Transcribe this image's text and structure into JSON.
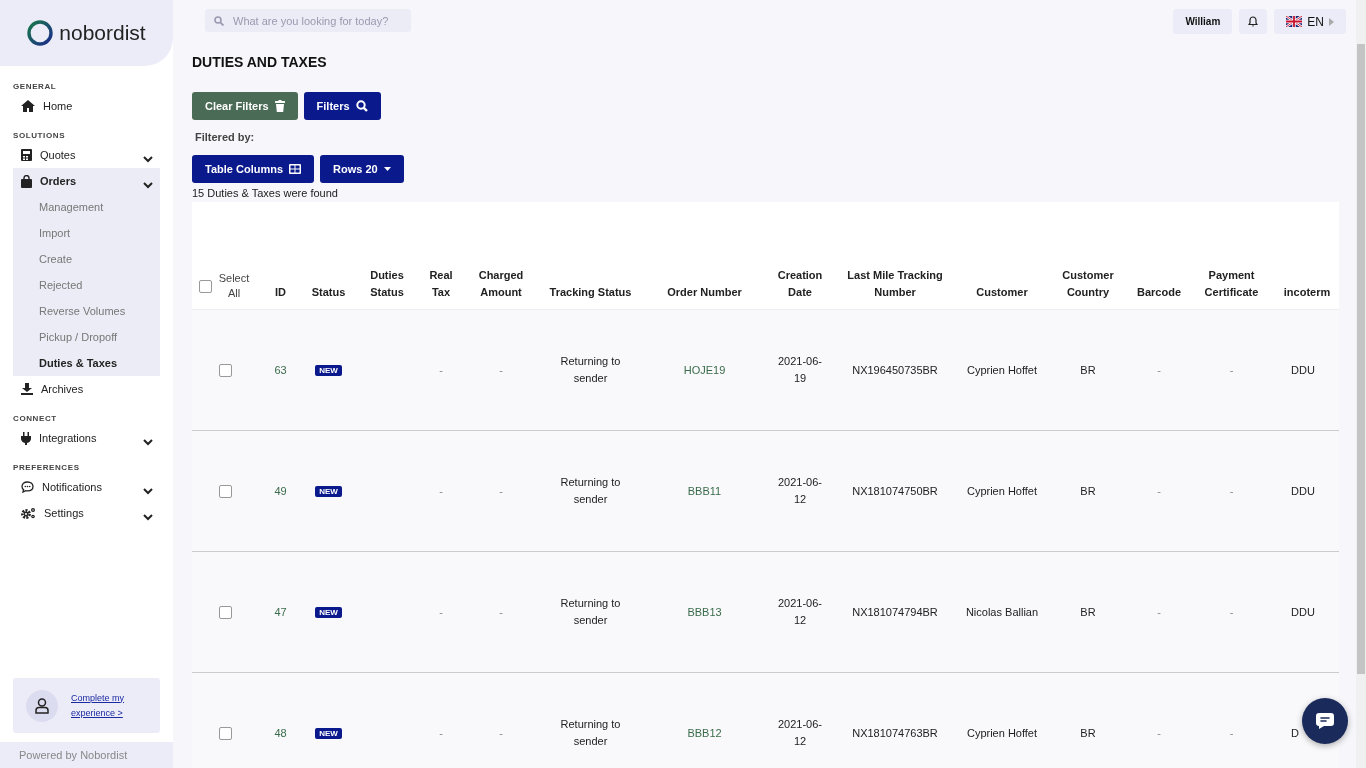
{
  "logo": {
    "text": "nobordist"
  },
  "search": {
    "placeholder": "What are you looking for today?"
  },
  "topbar": {
    "user": "William",
    "language": "EN"
  },
  "sidebar": {
    "sections": [
      {
        "title": "GENERAL",
        "items": [
          {
            "label": "Home",
            "selected": false
          }
        ]
      },
      {
        "title": "SOLUTIONS",
        "items": [
          {
            "label": "Quotes",
            "selected": false,
            "expanded": false
          },
          {
            "label": "Orders",
            "selected": true,
            "expanded": true,
            "children": [
              {
                "label": "Management",
                "selected": false
              },
              {
                "label": "Import",
                "selected": false
              },
              {
                "label": "Create",
                "selected": false
              },
              {
                "label": "Rejected",
                "selected": false
              },
              {
                "label": "Reverse Volumes",
                "selected": false
              },
              {
                "label": "Pickup / Dropoff",
                "selected": false
              },
              {
                "label": "Duties & Taxes",
                "selected": true
              }
            ]
          },
          {
            "label": "Archives",
            "selected": false
          }
        ]
      },
      {
        "title": "CONNECT",
        "items": [
          {
            "label": "Integrations",
            "selected": false,
            "expanded": false
          }
        ]
      },
      {
        "title": "PREFERENCES",
        "items": [
          {
            "label": "Notifications",
            "selected": false,
            "expanded": false
          },
          {
            "label": "Settings",
            "selected": false,
            "expanded": false
          }
        ]
      }
    ],
    "profile_link": "Complete my experience >",
    "footer": "Powered by Nobordist"
  },
  "page": {
    "title": "DUTIES AND TAXES",
    "clear_filters": "Clear Filters",
    "filters": "Filters",
    "filtered_by": "Filtered by:",
    "table_columns": "Table Columns",
    "rows": "Rows 20",
    "count": "15 Duties & Taxes were found"
  },
  "table": {
    "select_all": {
      "label": "Select All",
      "checked": false
    },
    "columns": [
      "ID",
      "Status",
      "Duties Status",
      "Real Tax",
      "Charged Amount",
      "Tracking Status",
      "Order Number",
      "Creation Date",
      "Last Mile Tracking Number",
      "Customer",
      "Customer Country",
      "Barcode",
      "Payment Certificate",
      "incoterm"
    ],
    "rows": [
      {
        "checked": false,
        "id": "63",
        "status": "NEW",
        "real_tax": "-",
        "charged_amount": "-",
        "tracking_status": "Returning to sender",
        "order_number": "HOJE19",
        "creation_date": "2021-06-19",
        "last_mile": "NX196450735BR",
        "customer": "Cyprien Hoffet",
        "country": "BR",
        "barcode": "-",
        "payment_certificate": "-",
        "incoterm": "DDU"
      },
      {
        "checked": false,
        "id": "49",
        "status": "NEW",
        "real_tax": "-",
        "charged_amount": "-",
        "tracking_status": "Returning to sender",
        "order_number": "BBB11",
        "creation_date": "2021-06-12",
        "last_mile": "NX181074750BR",
        "customer": "Cyprien Hoffet",
        "country": "BR",
        "barcode": "-",
        "payment_certificate": "-",
        "incoterm": "DDU"
      },
      {
        "checked": false,
        "id": "47",
        "status": "NEW",
        "real_tax": "-",
        "charged_amount": "-",
        "tracking_status": "Returning to sender",
        "order_number": "BBB13",
        "creation_date": "2021-06-12",
        "last_mile": "NX181074794BR",
        "customer": "Nicolas Ballian",
        "country": "BR",
        "barcode": "-",
        "payment_certificate": "-",
        "incoterm": "DDU"
      },
      {
        "checked": false,
        "id": "48",
        "status": "NEW",
        "real_tax": "-",
        "charged_amount": "-",
        "tracking_status": "Returning to sender",
        "order_number": "BBB12",
        "creation_date": "2021-06-12",
        "last_mile": "NX181074763BR",
        "customer": "Cyprien Hoffet",
        "country": "BR",
        "barcode": "-",
        "payment_certificate": "-",
        "incoterm": "D"
      }
    ]
  }
}
